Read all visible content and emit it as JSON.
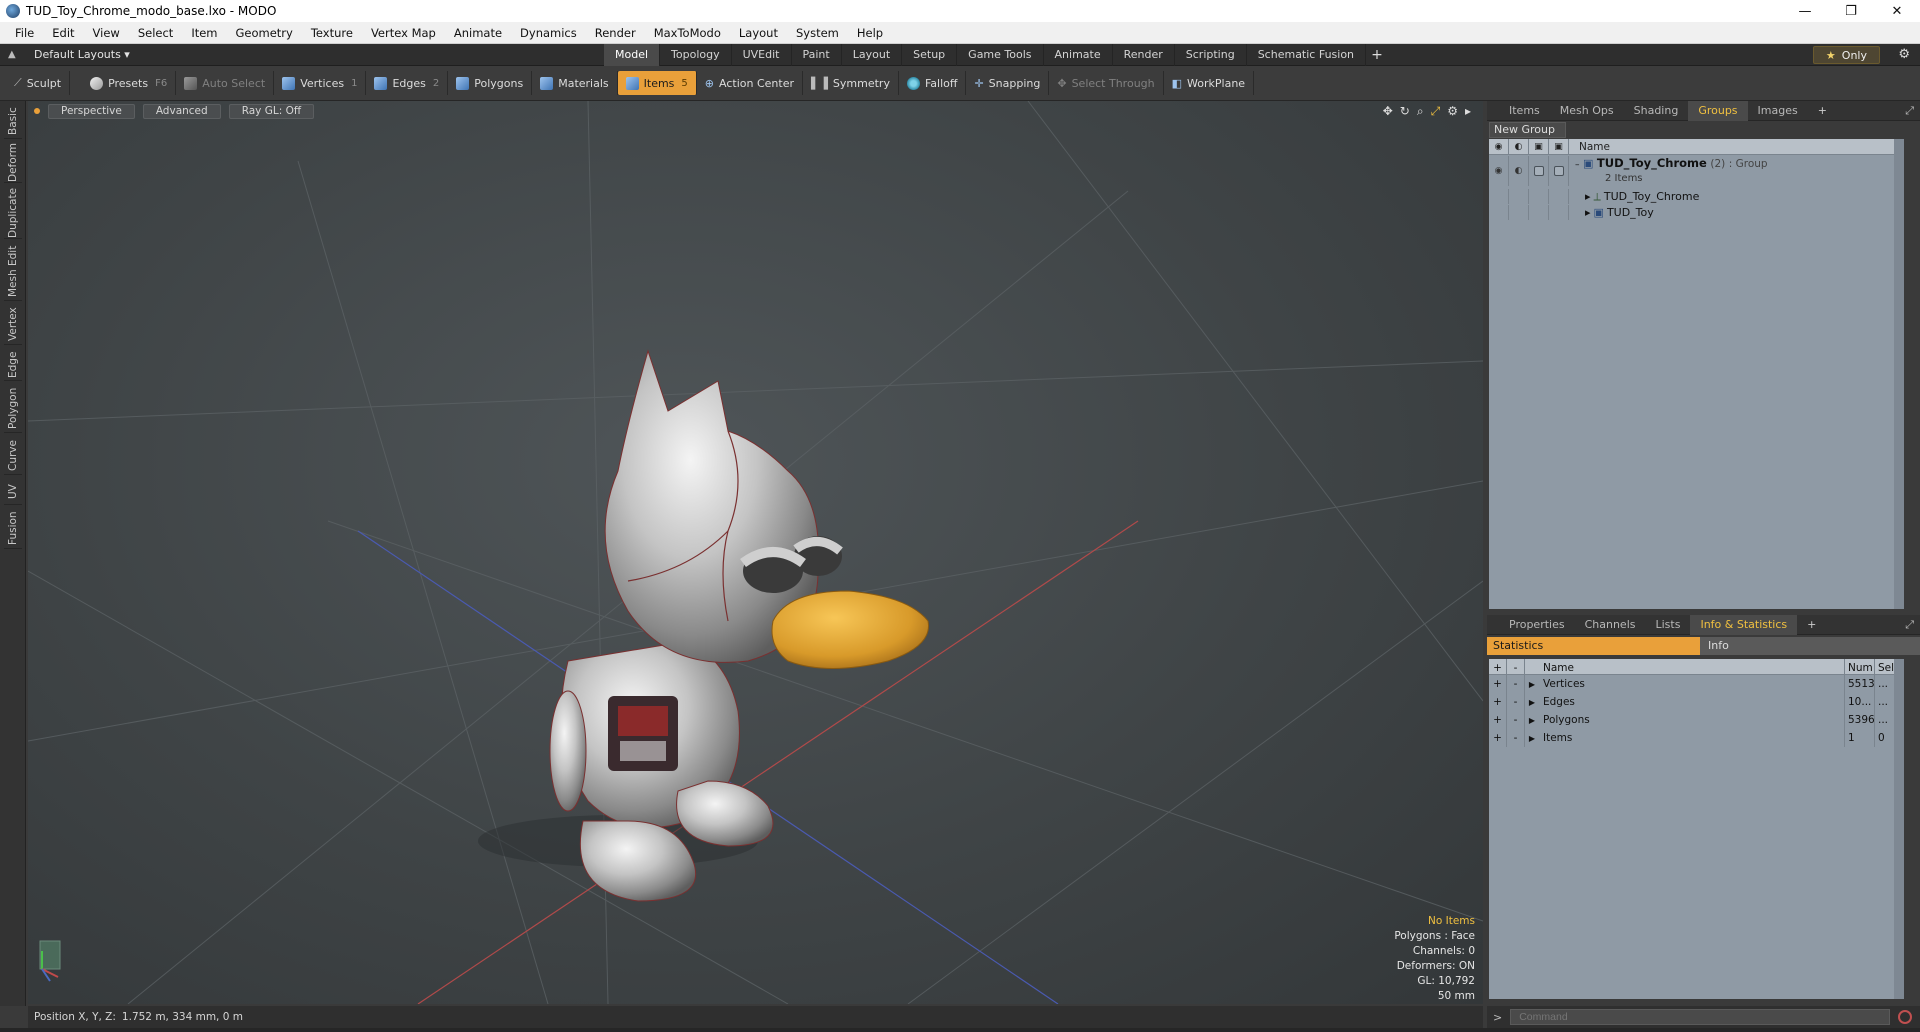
{
  "window": {
    "title": "TUD_Toy_Chrome_modo_base.lxo - MODO",
    "controls": {
      "minimize": "—",
      "maximize": "❐",
      "close": "✕"
    }
  },
  "menu": [
    "File",
    "Edit",
    "View",
    "Select",
    "Item",
    "Geometry",
    "Texture",
    "Vertex Map",
    "Animate",
    "Dynamics",
    "Render",
    "MaxToModo",
    "Layout",
    "System",
    "Help"
  ],
  "layoutbar": {
    "layout_label": "Default Layouts ▾",
    "tabs": [
      "Model",
      "Topology",
      "UVEdit",
      "Paint",
      "Layout",
      "Setup",
      "Game Tools",
      "Animate",
      "Render",
      "Scripting",
      "Schematic Fusion"
    ],
    "active_tab": "Model",
    "add_tab": "+",
    "only_label": "Only"
  },
  "toolbar": {
    "sculpt": "Sculpt",
    "presets": "Presets",
    "presets_key": "F6",
    "auto_select": "Auto Select",
    "vertices": "Vertices",
    "vertices_key": "1",
    "edges": "Edges",
    "edges_key": "2",
    "polygons": "Polygons",
    "materials": "Materials",
    "items": "Items",
    "items_key": "5",
    "action_center": "Action Center",
    "symmetry": "Symmetry",
    "falloff": "Falloff",
    "snapping": "Snapping",
    "select_through": "Select Through",
    "workplane": "WorkPlane"
  },
  "left_tabs": [
    "Basic",
    "Deform",
    "Duplicate",
    "Mesh Edit",
    "Vertex",
    "Edge",
    "Polygon",
    "Curve",
    "UV",
    "Fusion"
  ],
  "viewport": {
    "view": "Perspective",
    "mode": "Advanced",
    "raygl": "Ray GL: Off",
    "stats": {
      "no_items": "No Items",
      "polygons": "Polygons : Face",
      "channels": "Channels: 0",
      "deformers": "Deformers: ON",
      "gl": "GL: 10,792",
      "lens": "50 mm"
    }
  },
  "status": {
    "position_label": "Position X, Y, Z:",
    "position_value": "1.752 m, 334 mm, 0 m"
  },
  "groups_panel": {
    "tabs": [
      "Items",
      "Mesh Ops",
      "Shading",
      "Groups",
      "Images"
    ],
    "active_tab": "Groups",
    "new_group": "New Group",
    "column_name": "Name",
    "group": {
      "name": "TUD_Toy_Chrome",
      "count": "(2)",
      "type": ": Group",
      "sub": "2 Items"
    },
    "children": [
      "TUD_Toy_Chrome",
      "TUD_Toy"
    ]
  },
  "stats_panel": {
    "tabs": [
      "Properties",
      "Channels",
      "Lists",
      "Info & Statistics"
    ],
    "active_tab": "Info & Statistics",
    "sub_tabs": {
      "statistics": "Statistics",
      "info": "Info"
    },
    "columns": {
      "name": "Name",
      "num": "Num",
      "sel": "Sel"
    },
    "rows": [
      {
        "name": "Vertices",
        "num": "5513",
        "sel": "..."
      },
      {
        "name": "Edges",
        "num": "10...",
        "sel": "..."
      },
      {
        "name": "Polygons",
        "num": "5396",
        "sel": "..."
      },
      {
        "name": "Items",
        "num": "1",
        "sel": "0"
      }
    ]
  },
  "command": {
    "prompt": ">",
    "placeholder": "Command"
  }
}
